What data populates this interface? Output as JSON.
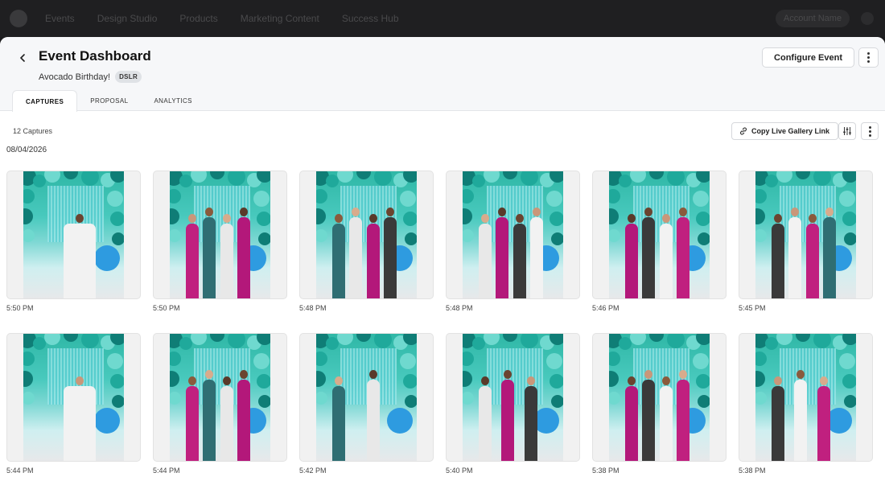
{
  "background_nav": {
    "items": [
      "Events",
      "Design Studio",
      "Products",
      "Marketing Content",
      "Success Hub"
    ],
    "account": "Account Name"
  },
  "header": {
    "title": "Event Dashboard",
    "event_name": "Avocado Birthday!",
    "badge": "DSLR",
    "configure_label": "Configure Event"
  },
  "tabs": [
    {
      "label": "CAPTURES",
      "active": true
    },
    {
      "label": "PROPOSAL",
      "active": false
    },
    {
      "label": "ANALYTICS",
      "active": false
    }
  ],
  "toolbar": {
    "count": "12 Captures",
    "copy_link_label": "Copy Live Gallery Link"
  },
  "date_group": "08/04/2026",
  "captures": [
    {
      "time": "5:50 PM"
    },
    {
      "time": "5:50 PM"
    },
    {
      "time": "5:48 PM"
    },
    {
      "time": "5:48 PM"
    },
    {
      "time": "5:46 PM"
    },
    {
      "time": "5:45 PM"
    },
    {
      "time": "5:44 PM"
    },
    {
      "time": "5:44 PM"
    },
    {
      "time": "5:42 PM"
    },
    {
      "time": "5:40 PM"
    },
    {
      "time": "5:38 PM"
    },
    {
      "time": "5:38 PM"
    }
  ],
  "colors": {
    "accent": "#2fb7a6",
    "header_bg": "#f6f7f9",
    "border": "#d6d8dc"
  }
}
